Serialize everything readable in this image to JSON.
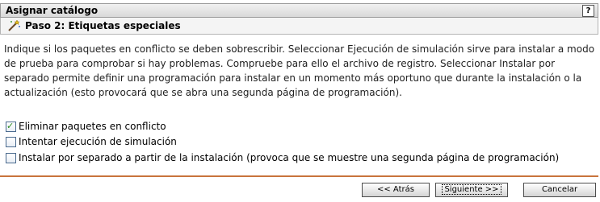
{
  "window": {
    "title": "Asignar catálogo",
    "help_label": "?"
  },
  "step": {
    "icon": "magic-wand-icon",
    "title": "Paso 2: Etiquetas especiales"
  },
  "description": "Indique si los paquetes en conflicto se deben sobrescribir. Seleccionar Ejecución de simulación sirve para instalar a modo de prueba para comprobar si hay problemas. Compruebe para ello el archivo de registro. Seleccionar Instalar por separado permite definir una programación para instalar en un momento más oportuno que durante la instalación o la actualización (esto provocará que se abra una segunda página de programación).",
  "options": [
    {
      "label": "Eliminar paquetes en conflicto",
      "checked": true
    },
    {
      "label": "Intentar ejecución de simulación",
      "checked": false
    },
    {
      "label": "Instalar por separado a partir de la instalación (provoca que se muestre una segunda página de programación)",
      "checked": false
    }
  ],
  "buttons": {
    "back": "<< Atrás",
    "next": "Siguiente >>",
    "cancel": "Cancelar"
  },
  "colors": {
    "divider": "#c8743c",
    "check": "#2a8a1f"
  }
}
